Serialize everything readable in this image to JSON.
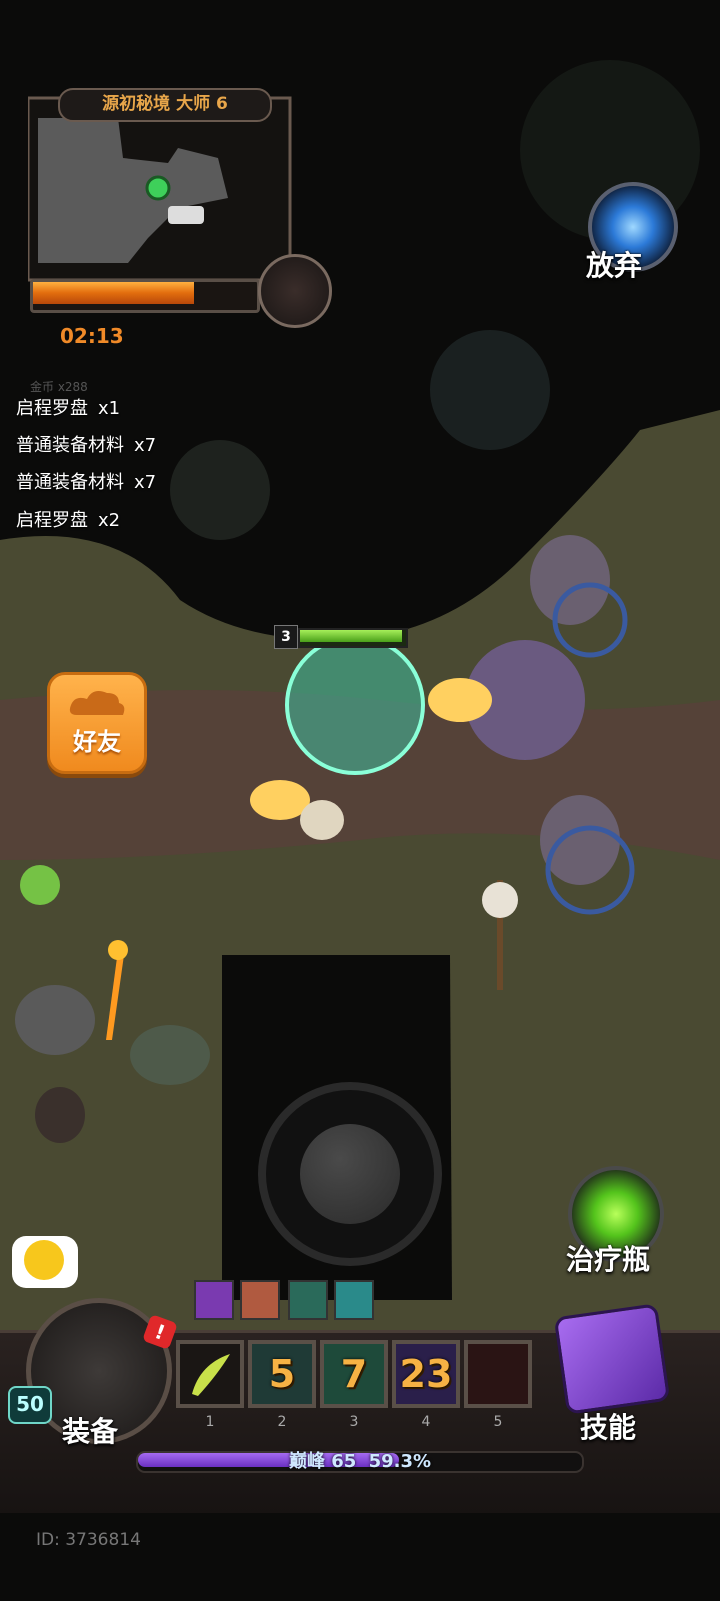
{
  "minimap": {
    "title": "源初秘境 大师 6",
    "timer": "02:13",
    "progress": 0.74
  },
  "abandon": {
    "label": "放弃",
    "icon": "portal-icon"
  },
  "coin_ghost": "金币 x288",
  "loot": [
    {
      "name": "启程罗盘",
      "count": "x1"
    },
    {
      "name": "普通装备材料",
      "count": "x7"
    },
    {
      "name": "普通装备材料",
      "count": "x7"
    },
    {
      "name": "启程罗盘",
      "count": "x2"
    }
  ],
  "friend": {
    "label": "好友",
    "icon": "cloud-icon"
  },
  "player": {
    "level_badge": "3",
    "hp": 1.0
  },
  "potion": {
    "label": "治疗瓶",
    "icon": "potion-icon"
  },
  "equip": {
    "label": "装备",
    "level": "50",
    "alert": "!"
  },
  "skills": {
    "label": "技能",
    "icon": "spellbook-icon"
  },
  "slots": [
    {
      "index": "1",
      "count": ""
    },
    {
      "index": "2",
      "count": "5"
    },
    {
      "index": "3",
      "count": "7"
    },
    {
      "index": "4",
      "count": "23"
    },
    {
      "index": "5",
      "count": ""
    }
  ],
  "xp": {
    "tier": "巅峰",
    "level": "65",
    "percent": "59.3%",
    "fraction": 0.593
  },
  "player_id": "ID: 3736814",
  "colors": {
    "accent": "#f08a28",
    "hp": "#7ad63a",
    "xp": "#8a4ad8"
  }
}
